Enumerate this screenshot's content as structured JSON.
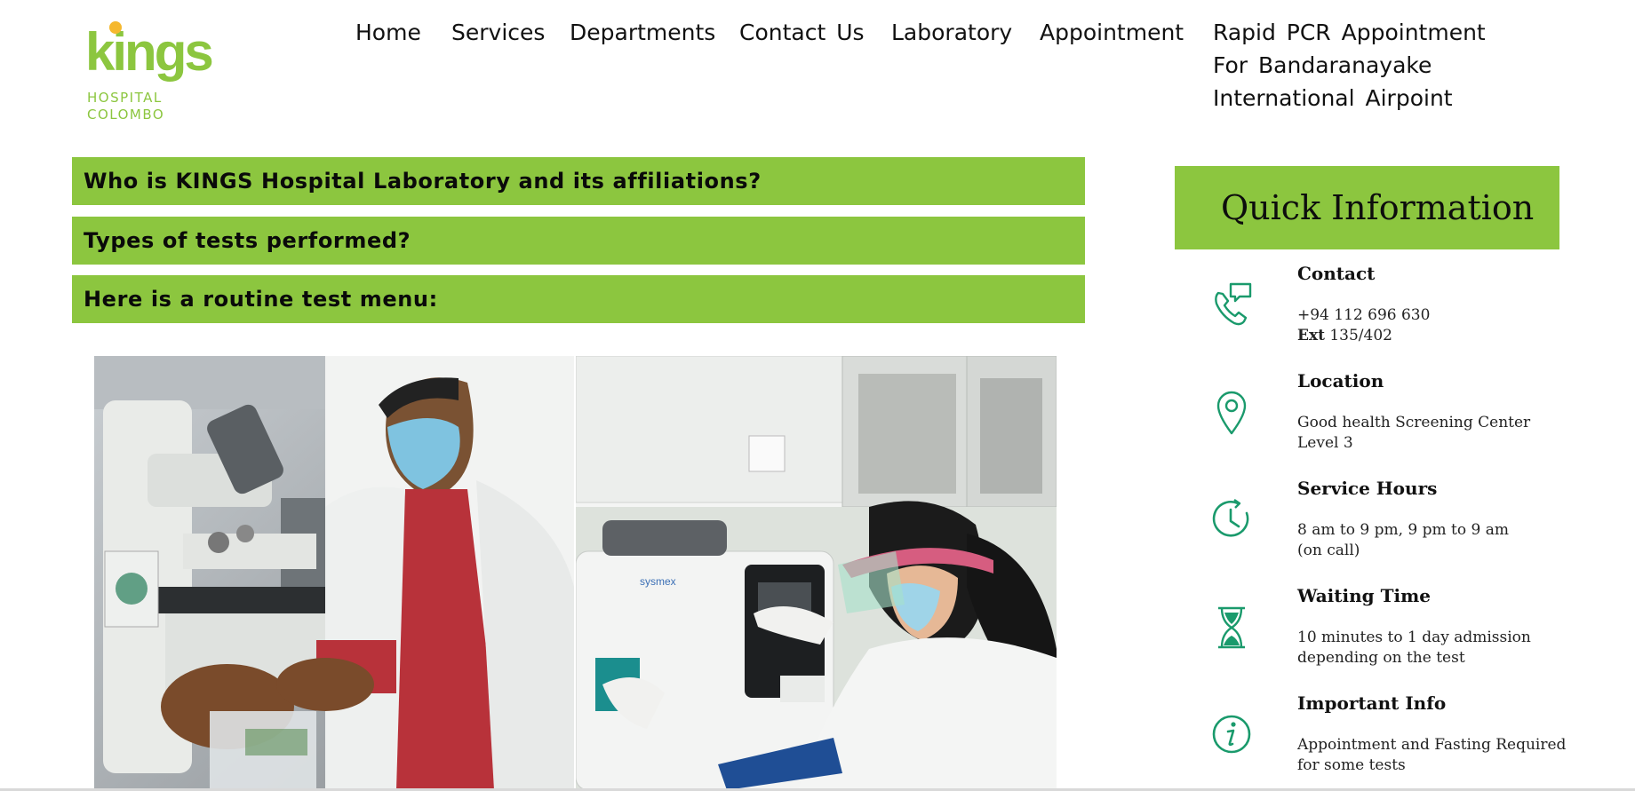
{
  "brand": {
    "logo_word": "kings",
    "logo_line1": "HOSPITAL",
    "logo_line2": "COLOMBO",
    "accent_color": "#8cc63f",
    "icon_color": "#1a9a6c"
  },
  "nav": {
    "items": [
      "Home",
      "Services",
      "Departments",
      "Contact  Us",
      "Laboratory",
      "Appointment",
      "Rapid  PCR  Appointment For  Bandaranayake International  Airpoint"
    ]
  },
  "accordion": {
    "items": [
      "Who is KINGS Hospital Laboratory and its affiliations?",
      "Types of tests performed?",
      "Here is a routine test menu:"
    ]
  },
  "photos": {
    "right_brand": "sysmex"
  },
  "quick_info": {
    "title": "Quick Information",
    "items": [
      {
        "icon": "phone-chat-icon",
        "label": "Contact",
        "line1": "+94 112 696 630",
        "line2_bold": "Ext",
        "line2": "135/402"
      },
      {
        "icon": "location-pin-icon",
        "label": "Location",
        "line1": "Good health Screening Center",
        "line2": "Level 3"
      },
      {
        "icon": "clock-icon",
        "label": "Service Hours",
        "line1": "8 am to 9 pm, 9 pm to 9 am",
        "line2": "(on call)"
      },
      {
        "icon": "hourglass-icon",
        "label": "Waiting Time",
        "line1": "10 minutes to 1 day admission",
        "line2": "depending on the test"
      },
      {
        "icon": "info-icon",
        "label": "Important Info",
        "line1": "Appointment and Fasting Required",
        "line2": "for some tests"
      }
    ]
  }
}
